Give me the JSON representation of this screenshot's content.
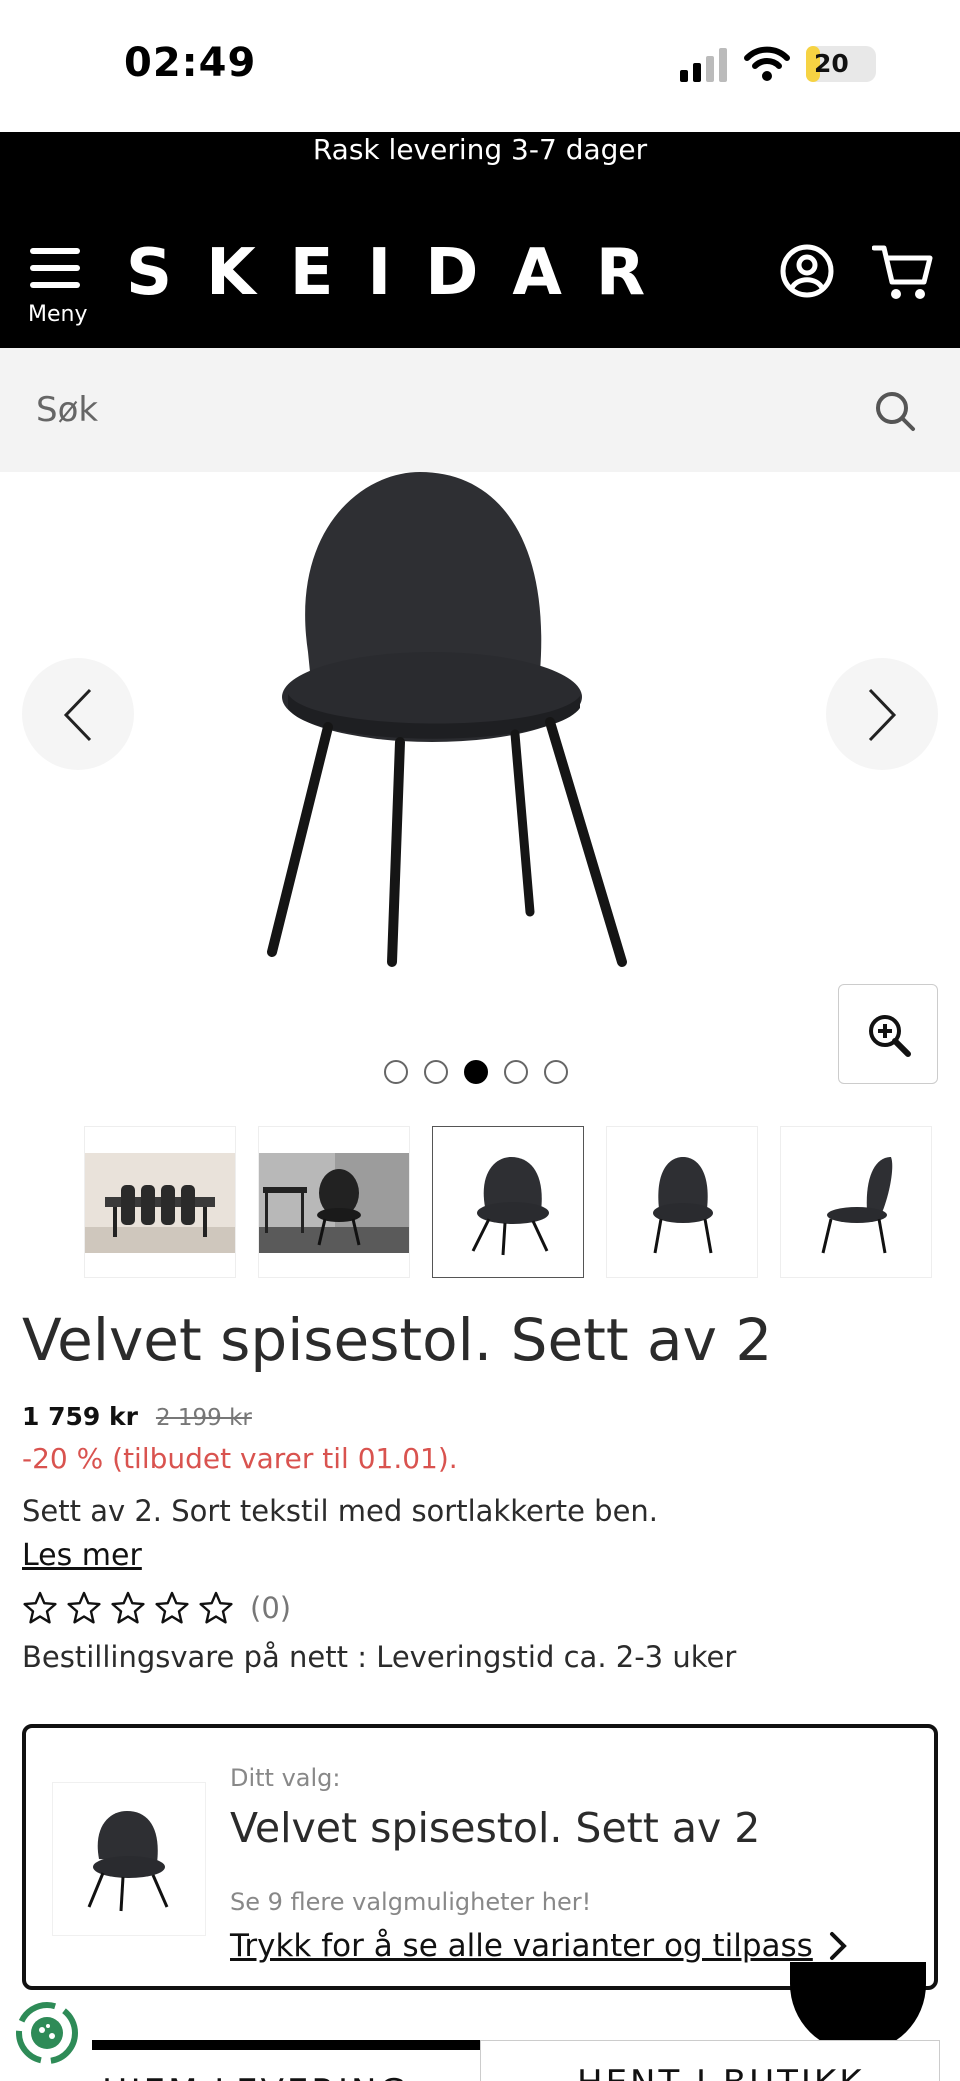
{
  "status_bar": {
    "time": "02:49",
    "battery": "20",
    "battery_level": 0.2
  },
  "promo": {
    "text": "Rask levering 3-7 dager"
  },
  "header": {
    "menu_label": "Meny",
    "logo": "SKEIDAR",
    "icons": [
      "hamburger-icon",
      "account-icon",
      "cart-icon"
    ]
  },
  "search": {
    "placeholder": "Søk"
  },
  "gallery": {
    "image_count": 5,
    "active_index": 2
  },
  "product": {
    "title": "Velvet spisestol. Sett av 2",
    "price": "1 759 kr",
    "old_price": "2 199 kr",
    "discount": "-20 % (tilbudet varer til 01.01).",
    "description": "Sett av 2. Sort tekstil med sortlakkerte ben.",
    "read_more": "Les mer",
    "rating_stars": 0,
    "review_count": "(0)",
    "delivery": "Bestillingsvare på nett : Leveringstid ca. 2-3 uker"
  },
  "choice": {
    "label": "Ditt valg:",
    "name": "Velvet spisestol. Sett av 2",
    "more_options": "Se 9 flere valgmuligheter her!",
    "link": "Trykk for å se alle varianter og tilpass"
  },
  "bottom_tabs": {
    "home_delivery": "HJEM LEVERING",
    "pickup": "HENT I BUTIKK"
  },
  "colors": {
    "accent_red": "#d9534f",
    "header_bg": "#000000",
    "battery_yellow": "#f6d343"
  }
}
